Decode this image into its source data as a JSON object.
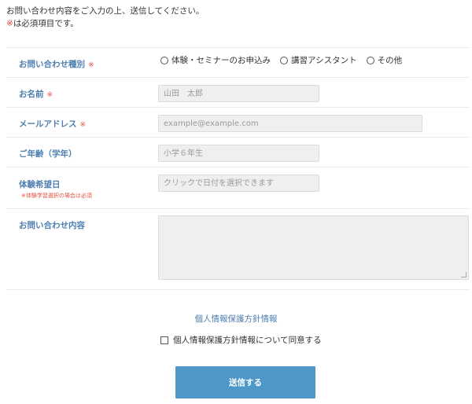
{
  "intro": {
    "line1": "お問い合わせ内容をご入力の上、送信してください。",
    "req_mark": "※",
    "line2": "は必須項目です。"
  },
  "form": {
    "required_mark": "※",
    "inquiry_type": {
      "label": "お問い合わせ種別",
      "options": [
        "体験・セミナーのお申込み",
        "講習アシスタント",
        "その他"
      ]
    },
    "name": {
      "label": "お名前",
      "placeholder": "山田　太郎"
    },
    "email": {
      "label": "メールアドレス",
      "placeholder": "example@example.com"
    },
    "age": {
      "label": "ご年齢（学年）",
      "placeholder": "小学６年生"
    },
    "date": {
      "label": "体験希望日",
      "note": "※体験学習選択の場合は必須",
      "placeholder": "クリックで日付を選択できます"
    },
    "message": {
      "label": "お問い合わせ内容"
    }
  },
  "privacy": {
    "link_text": "個人情報保護方針情報",
    "agree_text": "個人情報保護方針情報について同意する"
  },
  "submit_label": "送信する",
  "colors": {
    "label": "#4f7fb1",
    "required": "#e0523f",
    "button": "#4e97c9"
  }
}
